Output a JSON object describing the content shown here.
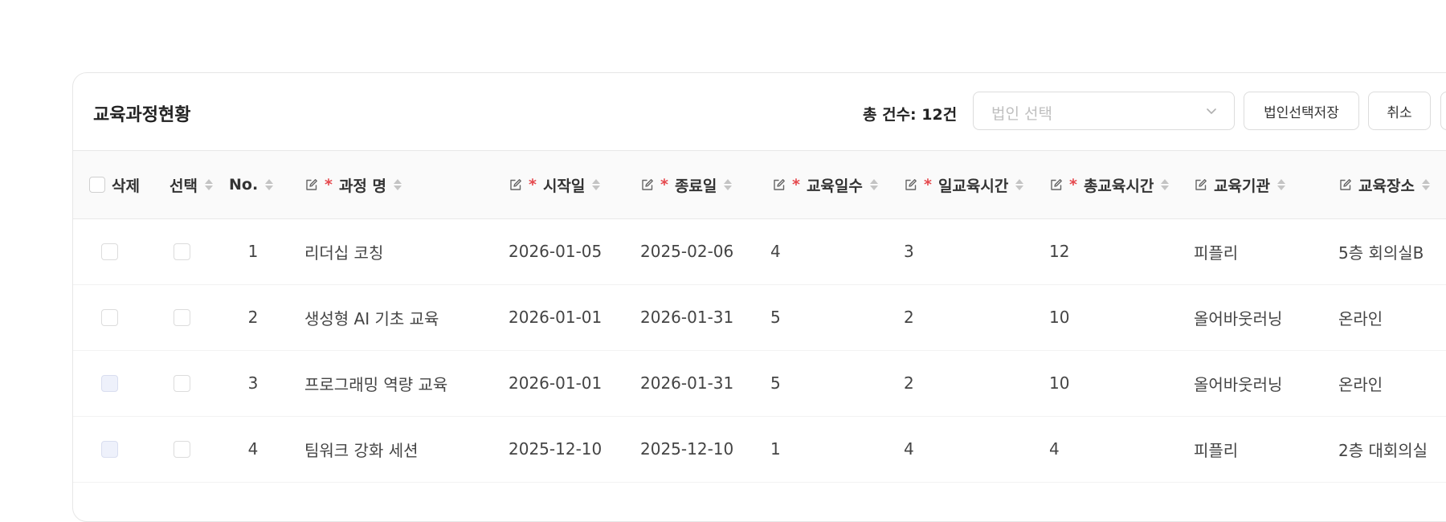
{
  "toolbar": {
    "title": "교육과정현황",
    "total_count": "총 건수: 12건",
    "corp_select_placeholder": "법인 선택",
    "save_corp_button": "법인선택저장",
    "cancel_button": "취소"
  },
  "columns": {
    "delete": "삭제",
    "select": "선택",
    "no": "No.",
    "course_name": "과정 명",
    "start_date": "시작일",
    "end_date": "종료일",
    "edu_days": "교육일수",
    "daily_hours": "일교육시간",
    "total_hours": "총교육시간",
    "institution": "교육기관",
    "location": "교육장소"
  },
  "rows": [
    {
      "delete_checked": false,
      "delete_tinted": false,
      "select_checked": false,
      "no": "1",
      "course_name": "리더십 코칭",
      "start_date": "2026-01-05",
      "end_date": "2025-02-06",
      "edu_days": "4",
      "daily_hours": "3",
      "total_hours": "12",
      "institution": "피플리",
      "location": "5층 회의실B"
    },
    {
      "delete_checked": false,
      "delete_tinted": false,
      "select_checked": false,
      "no": "2",
      "course_name": "생성형 AI 기초 교육",
      "start_date": "2026-01-01",
      "end_date": "2026-01-31",
      "edu_days": "5",
      "daily_hours": "2",
      "total_hours": "10",
      "institution": "올어바웃러닝",
      "location": "온라인"
    },
    {
      "delete_checked": false,
      "delete_tinted": true,
      "select_checked": false,
      "no": "3",
      "course_name": "프로그래밍 역량 교육",
      "start_date": "2026-01-01",
      "end_date": "2026-01-31",
      "edu_days": "5",
      "daily_hours": "2",
      "total_hours": "10",
      "institution": "올어바웃러닝",
      "location": "온라인"
    },
    {
      "delete_checked": false,
      "delete_tinted": true,
      "select_checked": false,
      "no": "4",
      "course_name": "팀워크 강화 세션",
      "start_date": "2025-12-10",
      "end_date": "2025-12-10",
      "edu_days": "1",
      "daily_hours": "4",
      "total_hours": "4",
      "institution": "피플리",
      "location": "2층 대회의실"
    }
  ],
  "icons": {
    "edit": "edit-icon",
    "sort": "sort-icon",
    "dropdown": "chevron-down-icon"
  },
  "colors": {
    "required_marker": "#e5484d",
    "header_bg": "#fafafa",
    "tinted_checkbox": "#eef1fb"
  }
}
